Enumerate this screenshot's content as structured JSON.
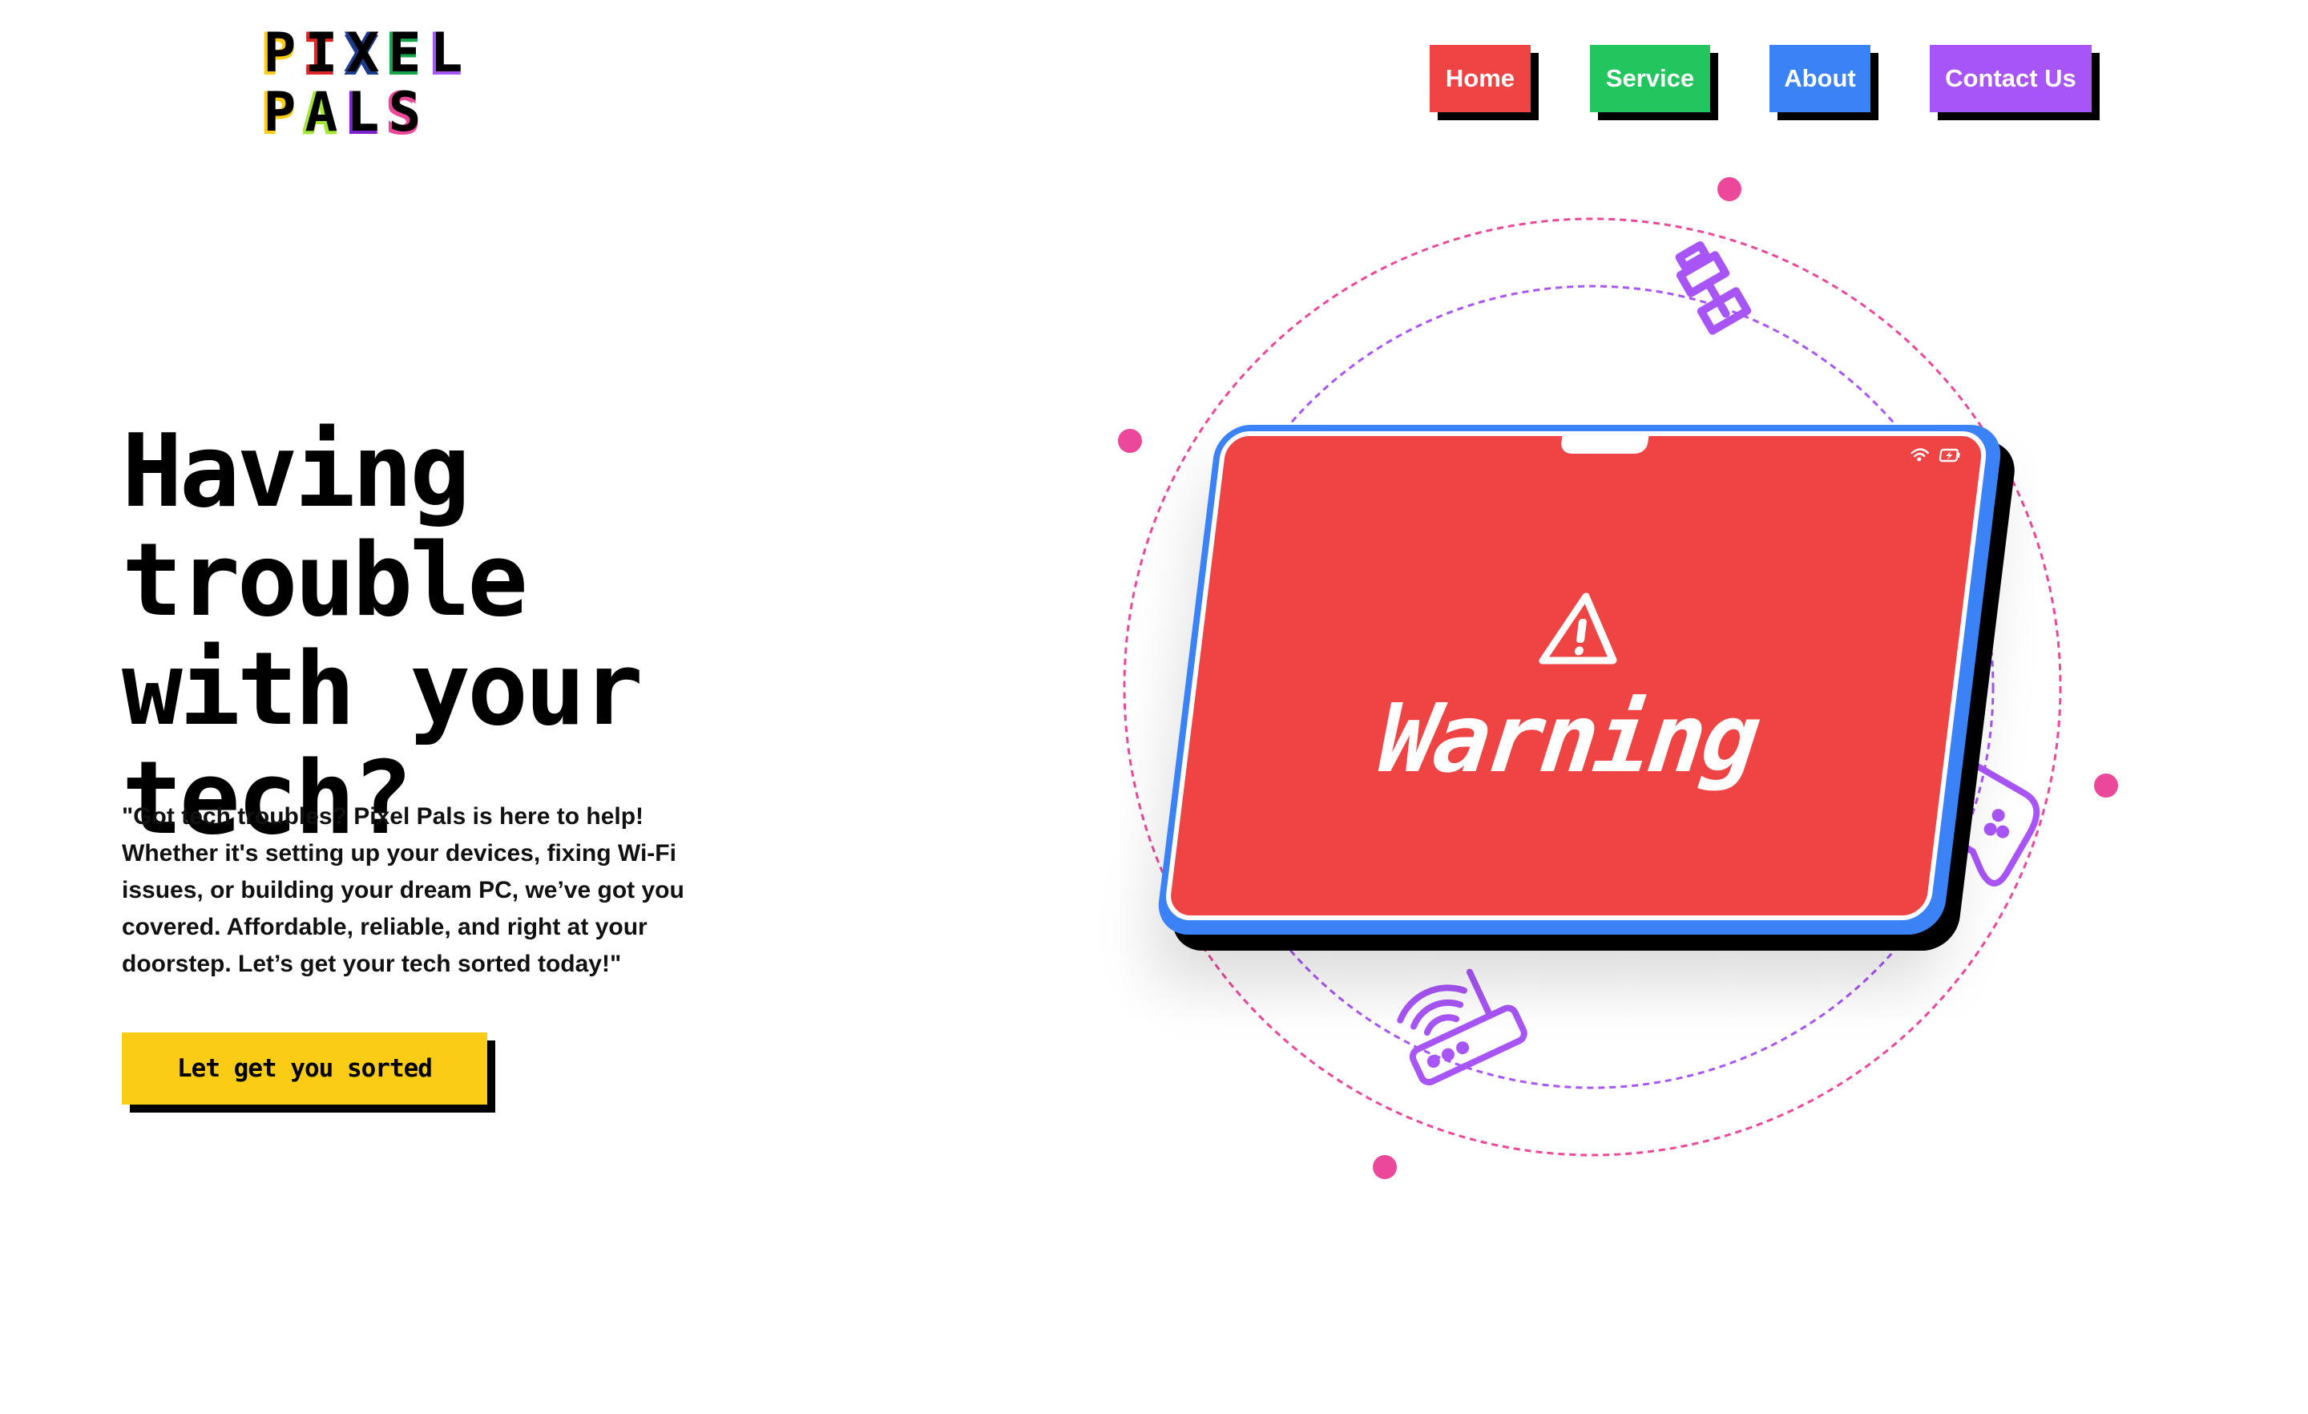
{
  "brand": {
    "logo_row1": [
      "P",
      "I",
      "X",
      "E",
      "L"
    ],
    "logo_row2": [
      "P",
      "A",
      "L",
      "S"
    ],
    "logo_colors_row1": [
      "#facc15",
      "#dc2626",
      "#1e3a8a",
      "#16a34a",
      "#a855f7"
    ],
    "logo_colors_row2": [
      "#facc15",
      "#a3e635",
      "#7e22ce",
      "#ec4899"
    ]
  },
  "nav": {
    "items": [
      {
        "label": "Home",
        "color": "#ef4444"
      },
      {
        "label": "Service",
        "color": "#22c55e"
      },
      {
        "label": "About",
        "color": "#3b82f6"
      },
      {
        "label": "Contact Us",
        "color": "#a855f7"
      }
    ]
  },
  "hero": {
    "title_line1": "Having trouble",
    "title_line2": "with your",
    "title_line3": "tech?",
    "description": "\"Got tech troubles? Pixel Pals is here to help! Whether it's setting up your devices, fixing Wi-Fi issues, or building your dream PC, we’ve got you covered. Affordable, reliable, and right at your doorstep. Let’s get your tech sorted today!\"",
    "cta_label": "Let get you sorted"
  },
  "illustration": {
    "screen_text": "Warning",
    "icons": [
      "usb-cable-icon",
      "wifi-router-icon",
      "gamepad-icon",
      "satellite-dish-icon",
      "warning-icon",
      "wifi-icon",
      "battery-icon"
    ],
    "colors": {
      "screen": "#ef4444",
      "frame": "#3b82f6",
      "orbit_outer": "#ec4899",
      "orbit_inner": "#a855f7",
      "dots": "#ec4899",
      "icons": "#a855f7"
    }
  }
}
